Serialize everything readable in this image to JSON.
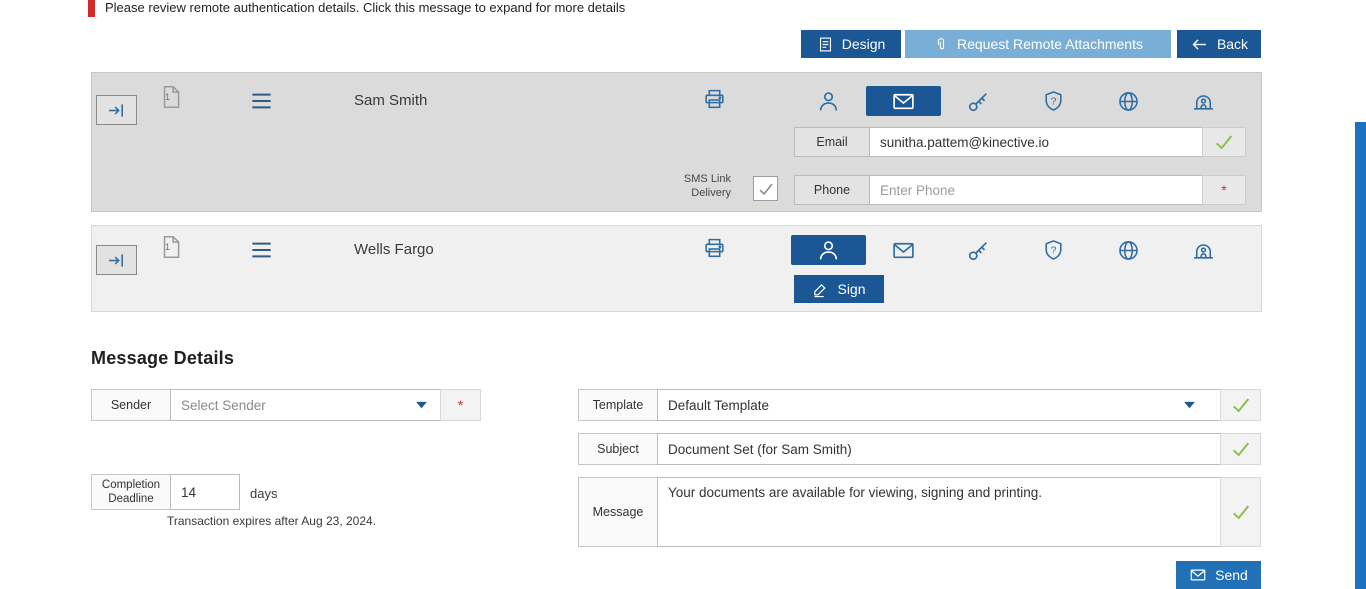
{
  "banner": {
    "text": "Please review remote authentication details. Click this message to expand for more details"
  },
  "toolbar": {
    "design": "Design",
    "attachments": "Request Remote Attachments",
    "back": "Back"
  },
  "recipients": [
    {
      "name": "Sam Smith",
      "doc_count": "1",
      "email_label": "Email",
      "email_value": "sunitha.pattem@kinective.io",
      "sms_label": "SMS Link Delivery",
      "phone_label": "Phone",
      "phone_placeholder": "Enter Phone",
      "required_marker": "*"
    },
    {
      "name": "Wells Fargo",
      "doc_count": "1",
      "sign_label": "Sign"
    }
  ],
  "message_details": {
    "title": "Message Details",
    "sender_label": "Sender",
    "sender_value": "Select Sender",
    "required_marker": "*",
    "deadline_label": "Completion Deadline",
    "deadline_value": "14",
    "deadline_unit": "days",
    "expires_note": "Transaction expires after Aug 23, 2024.",
    "template_label": "Template",
    "template_value": "Default Template",
    "subject_label": "Subject",
    "subject_value": "Document Set (for Sam Smith)",
    "message_label": "Message",
    "message_value": "Your documents are available for viewing, signing and printing.",
    "send_label": "Send"
  },
  "colors": {
    "primary_dark_blue": "#1a5794",
    "light_blue": "#79afd6",
    "bright_blue": "#2271b6",
    "icon_blue": "#2e6da4",
    "success_green": "#8cbf4a",
    "alert_red": "#d42a2a"
  }
}
